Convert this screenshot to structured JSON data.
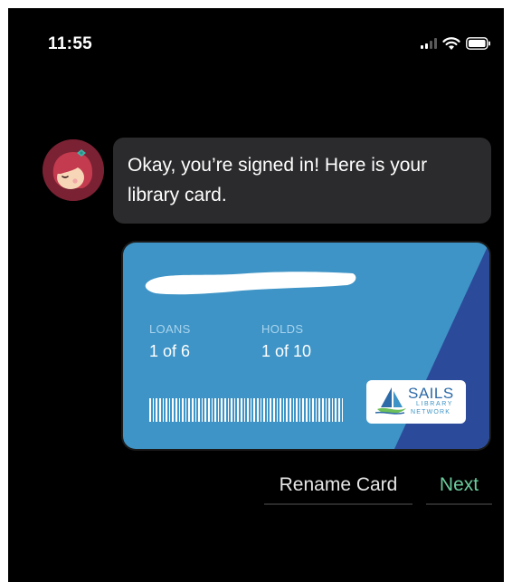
{
  "status_bar": {
    "time": "11:55",
    "icons": [
      "cellular-signal-icon",
      "wifi-icon",
      "battery-icon"
    ]
  },
  "chat": {
    "avatar_icon": "librarian-avatar-icon",
    "message": "Okay, you’re signed in! Here is your library card."
  },
  "card": {
    "name_redacted": true,
    "loans_label": "LOANS",
    "loans_value": "1 of 6",
    "holds_label": "HOLDS",
    "holds_value": "1 of 10",
    "barcode_icon": "barcode-icon",
    "logo": {
      "line1": "SAILS",
      "line2": "LIBRARY",
      "line3": "NETWORK"
    },
    "colors": {
      "card_blue": "#3e94c6",
      "card_dark_blue": "#2b4a9a"
    }
  },
  "actions": {
    "rename_label": "Rename Card",
    "next_label": "Next"
  },
  "colors": {
    "background": "#000000",
    "bubble": "#2b2b2d",
    "accent_green": "#6ccb9d"
  }
}
